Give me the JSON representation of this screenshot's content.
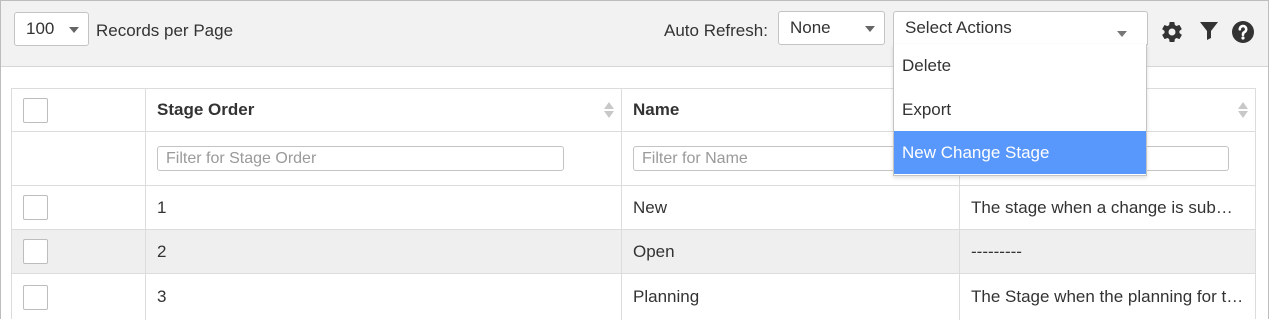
{
  "toolbar": {
    "records_per_page_value": "100",
    "records_per_page_label": "Records per Page",
    "auto_refresh_label": "Auto Refresh:",
    "auto_refresh_value": "None",
    "actions_placeholder": "Select Actions"
  },
  "actions_menu": {
    "items": [
      {
        "label": "Delete",
        "highlighted": false
      },
      {
        "label": "Export",
        "highlighted": false
      },
      {
        "label": "New Change Stage",
        "highlighted": true
      }
    ]
  },
  "icons": {
    "settings": "gear-icon",
    "filter": "filter-icon",
    "help": "question-circle-icon"
  },
  "colors": {
    "highlight": "#5897fb",
    "alt_row": "#efefef"
  },
  "table": {
    "columns": [
      {
        "label": ""
      },
      {
        "label": "Stage Order"
      },
      {
        "label": "Name"
      },
      {
        "label": ""
      }
    ],
    "filters": {
      "stage_order_placeholder": "Filter for Stage Order",
      "name_placeholder": "Filter for Name",
      "description_placeholder": ""
    },
    "rows": [
      {
        "order": "1",
        "name": "New",
        "description": "The stage when a change is submitted"
      },
      {
        "order": "2",
        "name": "Open",
        "description": "---------"
      },
      {
        "order": "3",
        "name": "Planning",
        "description": "The Stage when the planning for the change begins"
      }
    ]
  }
}
